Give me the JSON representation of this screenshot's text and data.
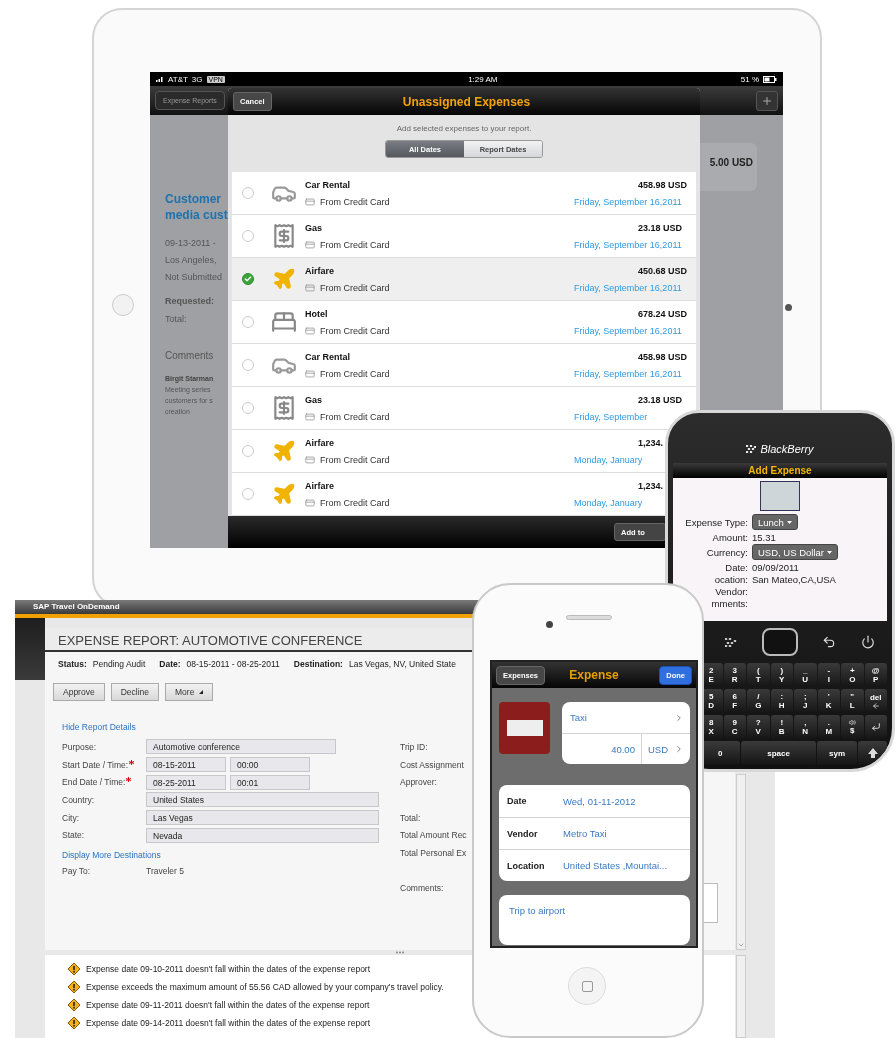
{
  "ipad": {
    "status_bar": {
      "carrier": "AT&T",
      "network": "3G",
      "vpn": "VPN",
      "time": "1:29 AM",
      "battery": "51 %"
    },
    "nav": {
      "back": "Expense Reports"
    },
    "report_behind": {
      "amount": "5.00 USD",
      "title_lines": [
        "Customer",
        "media cust"
      ],
      "details": [
        "09-13-2011 -",
        "Los Angeles,",
        "Not Submitted"
      ],
      "requested_label": "Requested:",
      "total_label": "Total:",
      "comments_heading": "Comments",
      "comment_author": "Birgit Starman",
      "comment_lines": [
        "Meeting series",
        "customers for s",
        "creation"
      ]
    },
    "modal": {
      "cancel": "Cancel",
      "title": "Unassigned Expenses",
      "prompt": "Add selected expenses to your report.",
      "segments": [
        {
          "label": "All Dates",
          "selected": true
        },
        {
          "label": "Report Dates",
          "selected": false
        }
      ],
      "expenses": [
        {
          "kind": "car",
          "name": "Car Rental",
          "source": "From Credit Card",
          "amount": "458.98 USD",
          "date": "Friday, September 16,2011",
          "selected": false
        },
        {
          "kind": "gas",
          "name": "Gas",
          "source": "From Credit Card",
          "amount": "23.18 USD",
          "date": "Friday, September 16,2011",
          "selected": false
        },
        {
          "kind": "airfare",
          "name": "Airfare",
          "source": "From Credit Card",
          "amount": "450.68 USD",
          "date": "Friday, September 16,2011",
          "selected": true
        },
        {
          "kind": "hotel",
          "name": "Hotel",
          "source": "From Credit Card",
          "amount": "678.24 USD",
          "date": "Friday, September 16,2011",
          "selected": false
        },
        {
          "kind": "car",
          "name": "Car Rental",
          "source": "From Credit Card",
          "amount": "458.98 USD",
          "date": "Friday, September 16,2011",
          "selected": false
        },
        {
          "kind": "gas",
          "name": "Gas",
          "source": "From Credit Card",
          "amount": "23.18 USD",
          "date": "Friday, September",
          "selected": false
        },
        {
          "kind": "airfare",
          "name": "Airfare",
          "source": "From Credit Card",
          "amount": "1,234.",
          "date": "Monday, January",
          "selected": false
        },
        {
          "kind": "airfare",
          "name": "Airfare",
          "source": "From Credit Card",
          "amount": "1,234.",
          "date": "Monday, January",
          "selected": false
        }
      ],
      "add_button": "Add to"
    }
  },
  "desktop": {
    "app_title": "SAP Travel OnDemand",
    "report_title": "EXPENSE REPORT: AUTOMOTIVE CONFERENCE",
    "summary": [
      {
        "label": "Status:",
        "value": "Pending Audit"
      },
      {
        "label": "Date:",
        "value": "08-15-2011 - 08-25-2011"
      },
      {
        "label": "Destination:",
        "value": "Las Vegas, NV, United State"
      }
    ],
    "actions": [
      {
        "label": "Approve",
        "kind": "plain"
      },
      {
        "label": "Decline",
        "kind": "plain"
      },
      {
        "label": "More",
        "kind": "menu"
      }
    ],
    "details_link": "Hide Report Details",
    "fields": [
      {
        "label": "Purpose:",
        "required": false,
        "kind": "medium",
        "values": [
          "Automotive conference"
        ]
      },
      {
        "label": "Start Date / Time:",
        "required": true,
        "kind": "pair",
        "values": [
          "08-15-2011",
          "00:00"
        ]
      },
      {
        "label": "End Date / Time:",
        "required": true,
        "kind": "pair",
        "values": [
          "08-25-2011",
          "00:01"
        ]
      },
      {
        "label": "Country:",
        "required": false,
        "kind": "long",
        "values": [
          "United States"
        ]
      },
      {
        "label": "City:",
        "required": false,
        "kind": "long",
        "values": [
          "Las Vegas"
        ]
      },
      {
        "label": "State:",
        "required": false,
        "kind": "long",
        "values": [
          "Nevada"
        ]
      }
    ],
    "destinations_link": "Display More Destinations",
    "pay_to": {
      "label": "Pay To:",
      "value": "Traveler 5"
    },
    "side_labels": [
      "Trip ID:",
      "Cost Assignment",
      "Approver:",
      "Total:",
      "Total Amount Rec",
      "Total Personal Ex",
      "Comments:"
    ],
    "warnings": [
      "Expense date 09-10-2011 doesn't fall within the dates of the expense report",
      "Expense exceeds the maximum amount of 55.56 CAD allowed by your company's travel policy.",
      "Expense date 09-11-2011 doesn't fall within the dates of the expense report",
      "Expense date 09-14-2011 doesn't fall within the dates of the expense report"
    ]
  },
  "blackberry": {
    "brand": "BlackBerry",
    "screen_title": "Add Expense",
    "fields": [
      {
        "label": "Expense Type:",
        "value": "Lunch",
        "kind": "select"
      },
      {
        "label": "Amount:",
        "value": "15.31",
        "kind": "text"
      },
      {
        "label": "Currency:",
        "value": "USD, US Dollar",
        "kind": "select"
      },
      {
        "label": "Date:",
        "value": "09/09/2011",
        "kind": "text"
      },
      {
        "label": "ocation:",
        "value": "San Mateo,CA,USA",
        "kind": "text"
      },
      {
        "label": "Vendor:",
        "kind": "text"
      },
      {
        "label": "mments:",
        "kind": "text"
      }
    ],
    "keys": [
      [
        {
          "kind": "char",
          "alt": "2",
          "main": "E"
        },
        {
          "kind": "char",
          "alt": "3",
          "main": "R"
        },
        {
          "kind": "char",
          "alt": "(",
          "main": "T"
        },
        {
          "kind": "char",
          "alt": ")",
          "main": "Y"
        },
        {
          "kind": "char",
          "alt": "_",
          "main": "U"
        },
        {
          "kind": "char",
          "alt": "-",
          "main": "I"
        },
        {
          "kind": "char",
          "alt": "+",
          "main": "O"
        },
        {
          "kind": "char",
          "alt": "@",
          "main": "P"
        }
      ],
      [
        {
          "kind": "char",
          "alt": "5",
          "main": "D"
        },
        {
          "kind": "char",
          "alt": "6",
          "main": "F"
        },
        {
          "kind": "char",
          "alt": "/",
          "main": "G"
        },
        {
          "kind": "char",
          "alt": ":",
          "main": "H"
        },
        {
          "kind": "char",
          "alt": ";",
          "main": "J"
        },
        {
          "kind": "char",
          "alt": "'",
          "main": "K"
        },
        {
          "kind": "char",
          "alt": "\"",
          "main": "L"
        },
        {
          "kind": "del",
          "main": "del"
        }
      ],
      [
        {
          "kind": "char",
          "alt": "8",
          "main": "X"
        },
        {
          "kind": "char",
          "alt": "9",
          "main": "C"
        },
        {
          "kind": "char",
          "alt": "?",
          "main": "V"
        },
        {
          "kind": "char",
          "alt": "!",
          "main": "B"
        },
        {
          "kind": "char",
          "alt": ",",
          "main": "N"
        },
        {
          "kind": "char",
          "alt": ".",
          "main": "M"
        },
        {
          "kind": "speaker",
          "main": "$"
        },
        {
          "kind": "enter"
        }
      ],
      [
        {
          "kind": "word",
          "main": "0"
        },
        {
          "kind": "space",
          "main": "space"
        },
        {
          "kind": "word",
          "main": "sym"
        },
        {
          "kind": "shift"
        }
      ]
    ]
  },
  "iphone": {
    "back": "Expenses",
    "title": "Expense",
    "done": "Done",
    "type": "Taxi",
    "amount": "40.00",
    "currency": "USD",
    "details": [
      {
        "label": "Date",
        "value": "Wed, 01-11-2012"
      },
      {
        "label": "Vendor",
        "value": "Metro Taxi"
      },
      {
        "label": "Location",
        "value": "United States ,Mountai..."
      }
    ],
    "note": "Trip to airport"
  }
}
